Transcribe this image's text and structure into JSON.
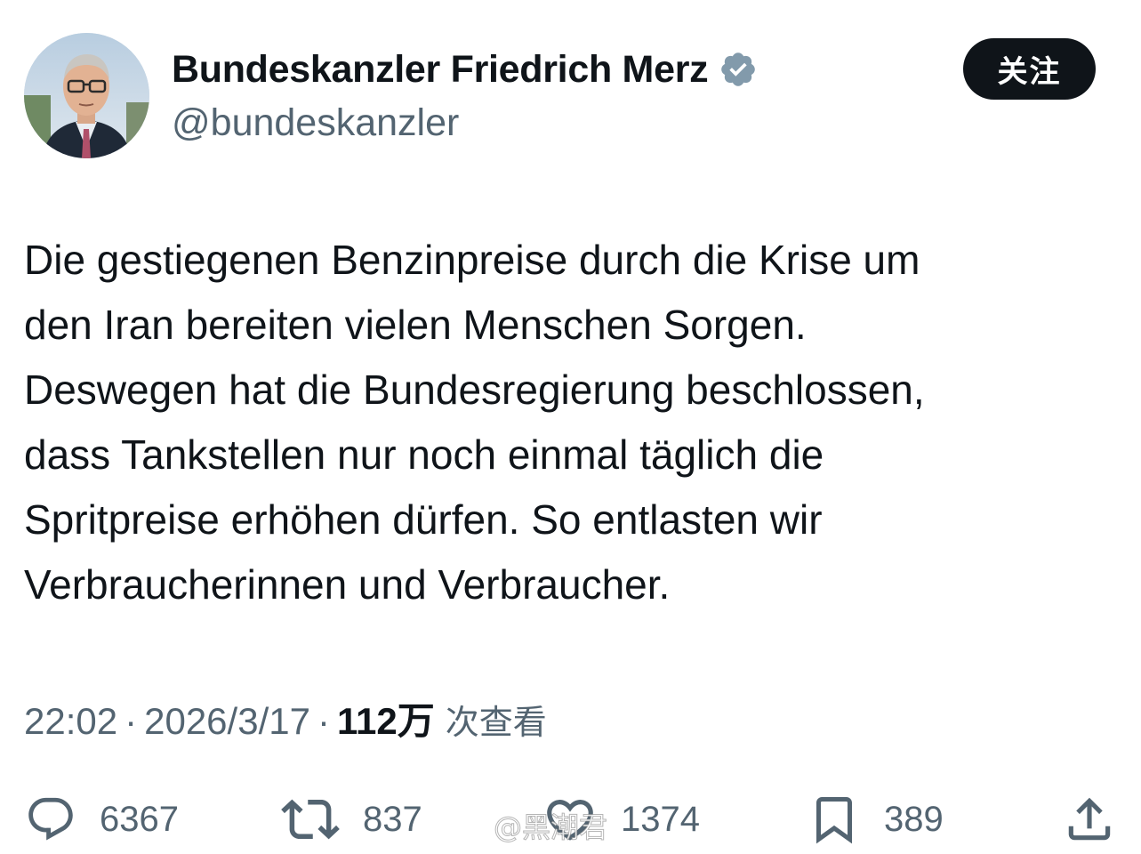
{
  "author": {
    "display_name": "Bundeskanzler Friedrich Merz",
    "handle": "@bundeskanzler",
    "verified": true
  },
  "follow_button": {
    "label": "关注"
  },
  "tweet": {
    "lines": [
      "Die gestiegenen Benzinpreise durch die Krise um",
      "den Iran bereiten vielen Menschen Sorgen.",
      "Deswegen hat die Bundesregierung beschlossen,",
      "dass Tankstellen nur noch einmal täglich die",
      "Spritpreise erhöhen dürfen. So entlasten wir",
      "Verbraucherinnen und Verbraucher."
    ]
  },
  "meta": {
    "time": "22:02",
    "date": "2026/3/17",
    "separator": "·",
    "views_count": "112万",
    "views_label": "次查看"
  },
  "actions": {
    "replies": "6367",
    "retweets": "837",
    "likes": "1374",
    "bookmarks": "389"
  },
  "icons": {
    "reply": "speech-bubble-icon",
    "retweet": "retweet-arrows-icon",
    "like": "heart-icon",
    "bookmark": "bookmark-icon",
    "share": "share-upload-icon",
    "verified": "verified-badge-icon"
  },
  "colors": {
    "text": "#0f1419",
    "secondary_text": "#536471",
    "follow_button_bg": "#0f1419",
    "verified_badge": "#829aab"
  },
  "watermark": "@黑潮君"
}
